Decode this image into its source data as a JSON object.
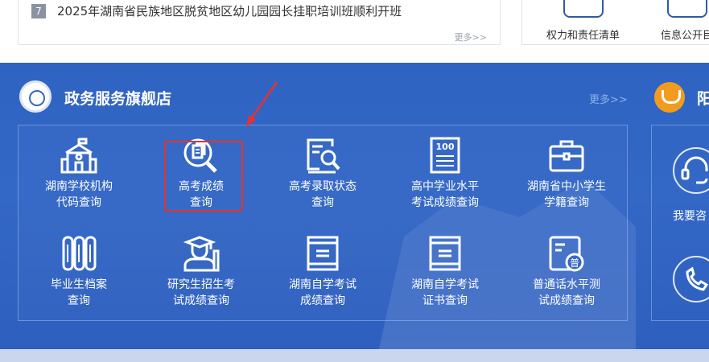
{
  "news": {
    "item_number": "7",
    "item_title": "2025年湖南省民族地区脱贫地区幼儿园园长挂职培训班顺利开班",
    "more_label": "更多>>"
  },
  "quick_links": [
    {
      "label": "权力和责任清单"
    },
    {
      "label": "信息公开目"
    }
  ],
  "section": {
    "title": "政务服务旗舰店",
    "more_label": "更多>>",
    "right_title": "阳"
  },
  "services": [
    {
      "line1": "湖南学校机构",
      "line2": "代码查询",
      "icon": "school-building-icon"
    },
    {
      "line1": "高考成绩",
      "line2": "查询",
      "icon": "document-search-icon"
    },
    {
      "line1": "高考录取状态",
      "line2": "查询",
      "icon": "form-search-icon"
    },
    {
      "line1": "高中学业水平",
      "line2": "考试成绩查询",
      "icon": "score-sheet-100-icon"
    },
    {
      "line1": "湖南省中小学生",
      "line2": "学籍查询",
      "icon": "briefcase-icon"
    },
    {
      "line1": "毕业生档案",
      "line2": "查询",
      "icon": "archive-binders-icon"
    },
    {
      "line1": "研究生招生考",
      "line2": "试成绩查询",
      "icon": "graduate-icon"
    },
    {
      "line1": "湖南自学考试",
      "line2": "成绩查询",
      "icon": "book-icon"
    },
    {
      "line1": "湖南自学考试",
      "line2": "证书查询",
      "icon": "book-icon"
    },
    {
      "line1": "普通话水平测",
      "line2": "试成绩查询",
      "icon": "putonghua-certificate-icon"
    }
  ],
  "side_services": [
    {
      "label": "我要咨",
      "icon": "headset-icon"
    },
    {
      "label": "",
      "icon": "phone-icon"
    }
  ],
  "icon_text": {
    "score_badge": "100",
    "putonghua_badge": "普"
  },
  "colors": {
    "band_blue": "#3468c6",
    "highlight_red": "#e8322b",
    "logo_orange": "#f29c1f"
  }
}
